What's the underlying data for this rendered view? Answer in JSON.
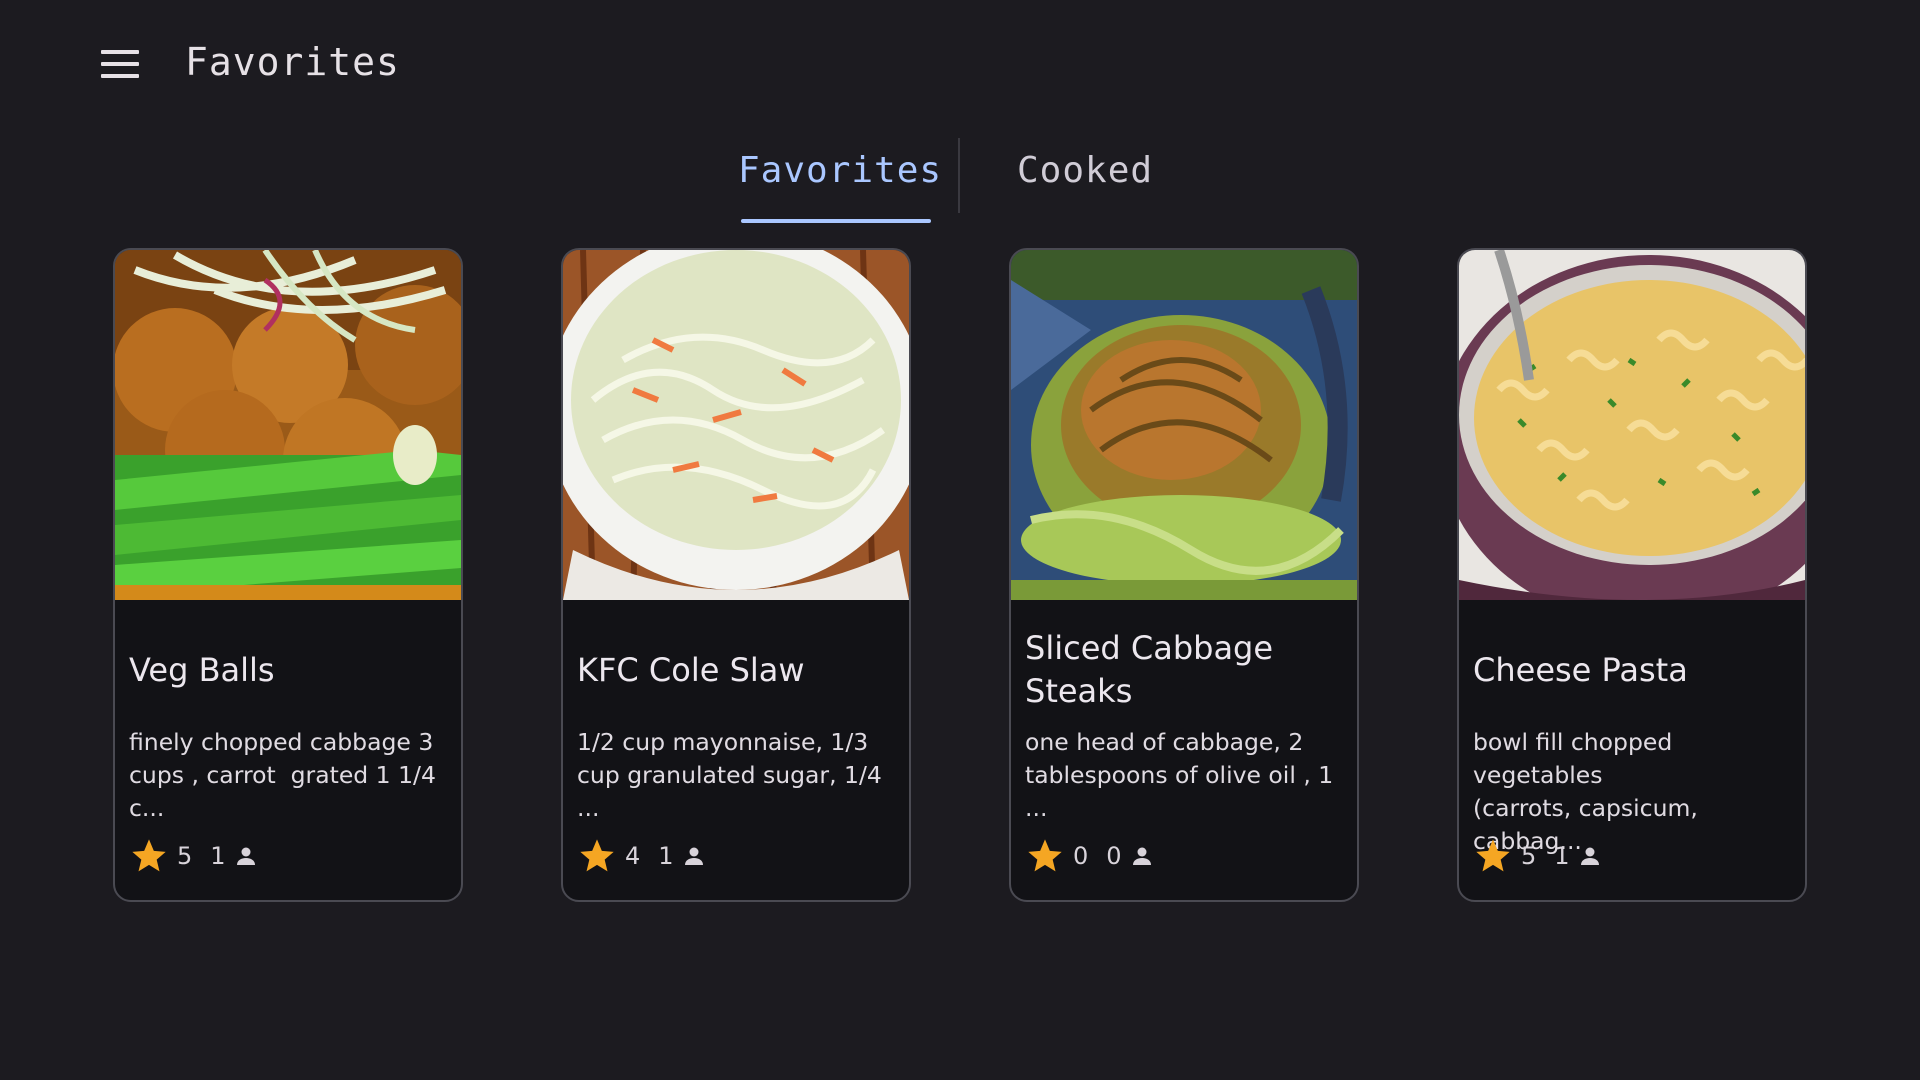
{
  "app_bar": {
    "title": "Favorites",
    "menu_icon": "hamburger-menu-icon"
  },
  "tabs": [
    {
      "label": "Favorites",
      "selected": true
    },
    {
      "label": "Cooked",
      "selected": false
    }
  ],
  "colors": {
    "background": "#1c1b20",
    "card": "#121216",
    "accent": "#aac7ff",
    "star": "#f5a623"
  },
  "recipes": [
    {
      "title": "Veg Balls",
      "description": "finely chopped cabbage 3\ncups , carrot  grated 1 1/4 c...",
      "rating": "5",
      "count": "1",
      "image": "veg-balls-photo"
    },
    {
      "title": "KFC Cole Slaw",
      "description": "1/2 cup mayonnaise, 1/3\ncup granulated sugar, 1/4 ...",
      "rating": "4",
      "count": "1",
      "image": "cole-slaw-photo"
    },
    {
      "title": "Sliced Cabbage Steaks",
      "description": "one head of cabbage, 2\ntablespoons of olive oil , 1 ...",
      "rating": "0",
      "count": "0",
      "image": "cabbage-steaks-photo"
    },
    {
      "title": "Cheese Pasta",
      "description": "bowl fill chopped vegetables\n(carrots, capsicum, cabbag...",
      "rating": "5",
      "count": "1",
      "image": "cheese-pasta-photo"
    }
  ]
}
